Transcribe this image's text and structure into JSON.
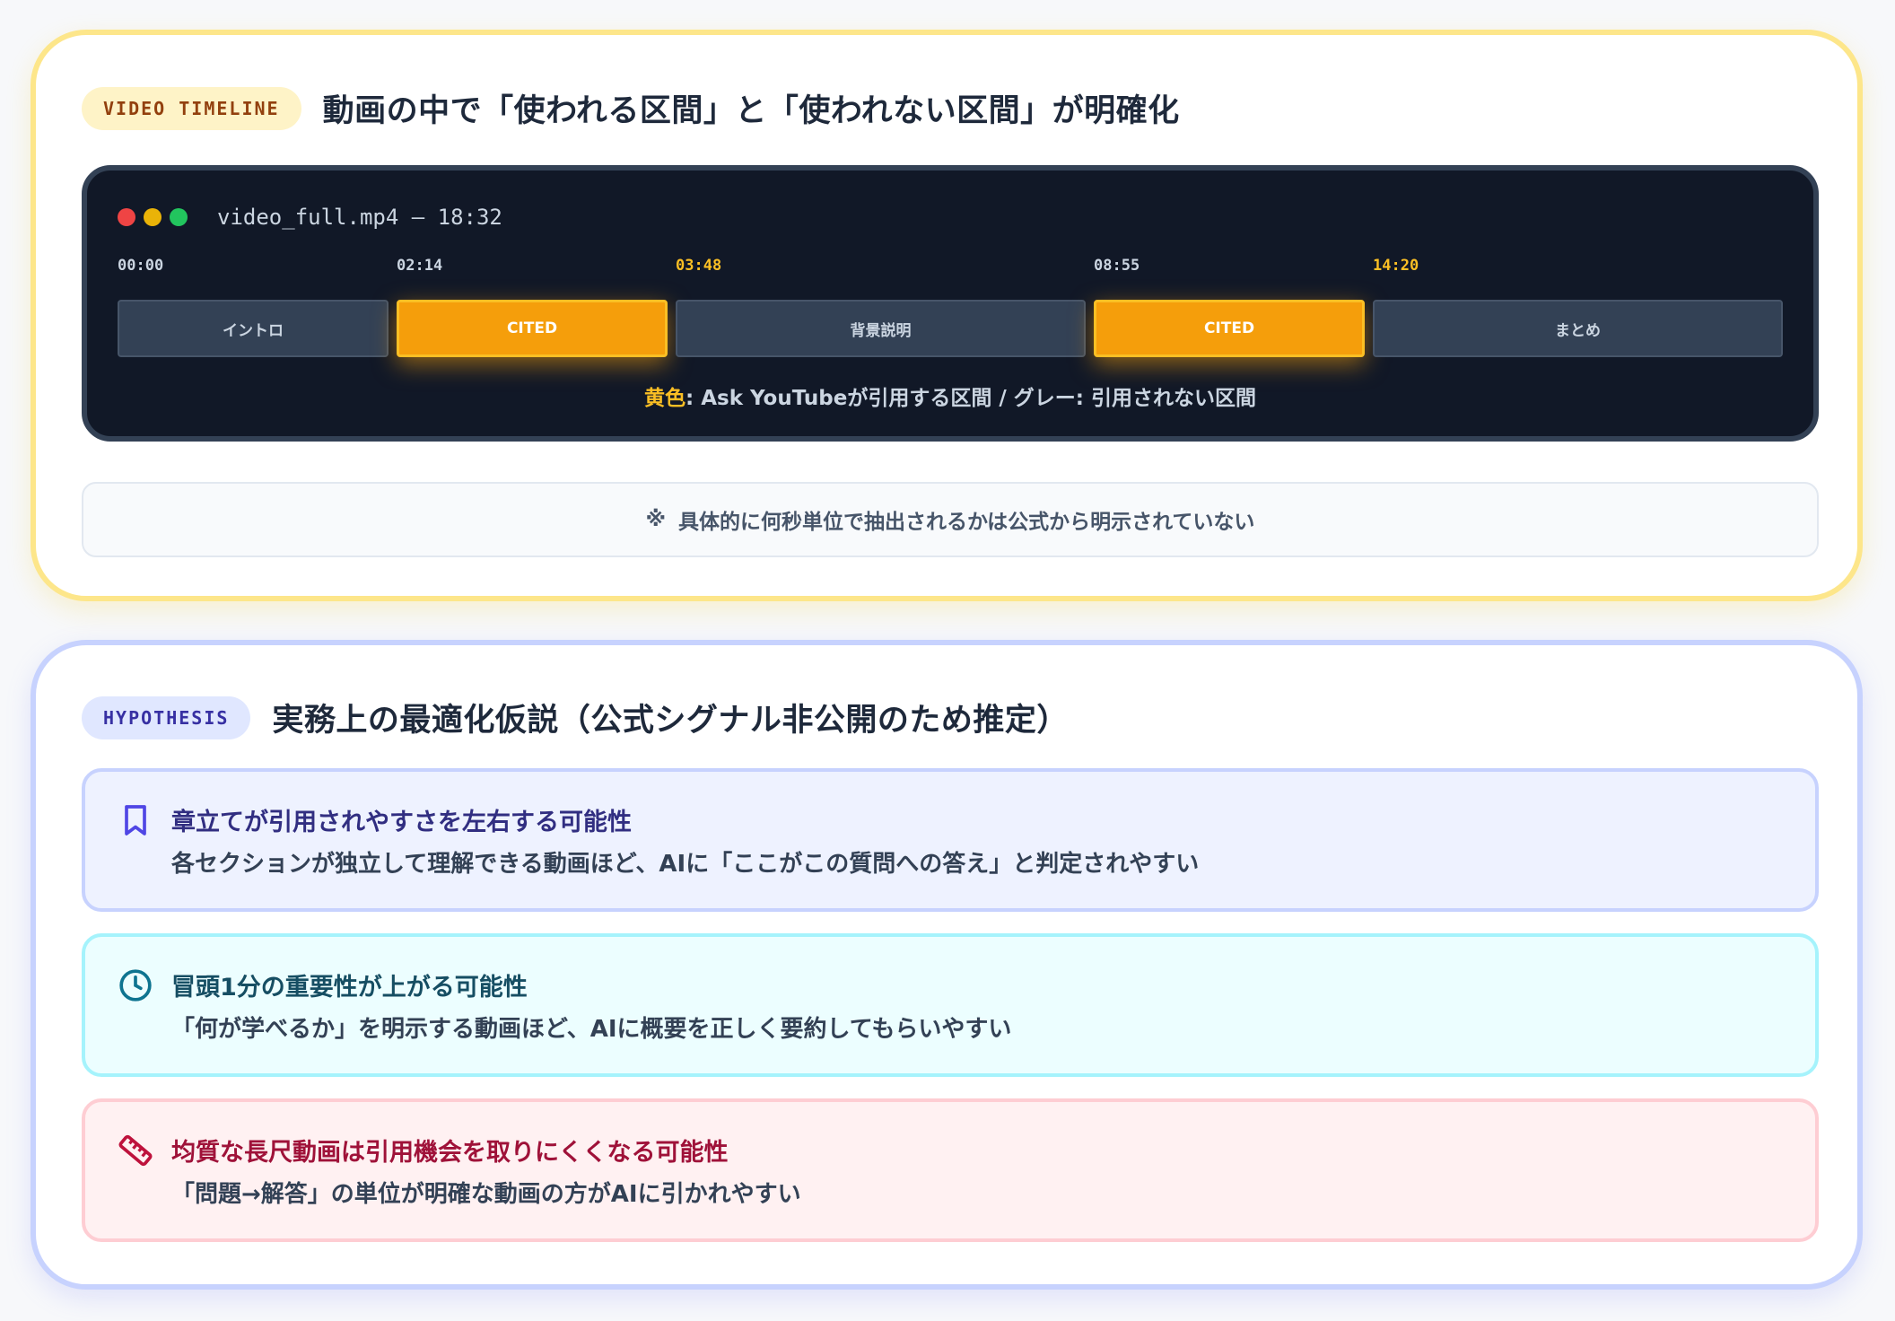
{
  "timeline_card": {
    "badge": "VIDEO TIMELINE",
    "title": "動画の中で「使われる区間」と「使われない区間」が明確化",
    "player": {
      "file_label": "video_full.mp4 — 18:32",
      "ticks": [
        {
          "label": "00:00",
          "highlight": false
        },
        {
          "label": "02:14",
          "highlight": false
        },
        {
          "label": "03:48",
          "highlight": true
        },
        {
          "label": "08:55",
          "highlight": false
        },
        {
          "label": "14:20",
          "highlight": true
        }
      ],
      "segments": [
        {
          "label": "イントロ",
          "cited": false
        },
        {
          "label": "CITED",
          "cited": true
        },
        {
          "label": "背景説明",
          "cited": false
        },
        {
          "label": "CITED",
          "cited": true
        },
        {
          "label": "まとめ",
          "cited": false
        }
      ],
      "legend": {
        "yellow_key": "黄色",
        "yellow_text": ": Ask YouTubeが引用する区間 / ",
        "gray_key": "グレー",
        "gray_text": ": 引用されない区間"
      }
    },
    "note": {
      "mark": "※",
      "text": "具体的に何秒単位で抽出されるかは公式から明示されていない"
    }
  },
  "hypothesis_card": {
    "badge": "HYPOTHESIS",
    "title": "実務上の最適化仮説（公式シグナル非公開のため推定）",
    "items": [
      {
        "icon": "bookmark-icon",
        "title": "章立てが引用されやすさを左右する可能性",
        "description": "各セクションが独立して理解できる動画ほど、AIに「ここがこの質問への答え」と判定されやすい",
        "accent": "#4f46e5"
      },
      {
        "icon": "clock-icon",
        "title": "冒頭1分の重要性が上がる可能性",
        "description": "「何が学べるか」を明示する動画ほど、AIに概要を正しく要約してもらいやすい",
        "accent": "#0e7490"
      },
      {
        "icon": "ruler-icon",
        "title": "均質な長尺動画は引用機会を取りにくくなる可能性",
        "description": "「問題→解答」の単位が明確な動画の方がAIに引かれやすい",
        "accent": "#be123c"
      }
    ]
  },
  "colors": {
    "cited": "#f59e0b",
    "timeline_border": "#fde68a",
    "hypothesis_border": "#c7d2fe",
    "player_bg": "#111827"
  }
}
